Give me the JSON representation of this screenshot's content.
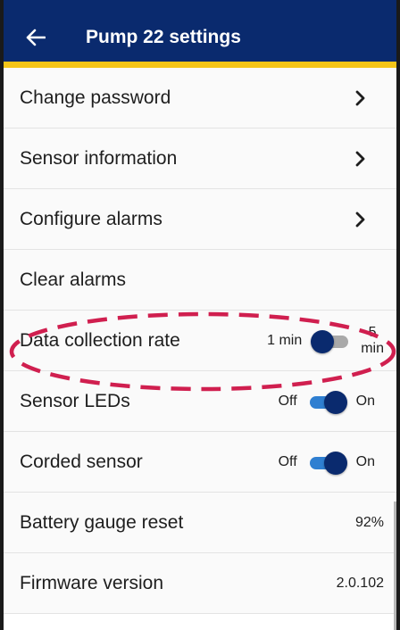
{
  "header": {
    "title": "Pump 22 settings",
    "back_icon": "arrow-left-icon",
    "bar_color": "#0a2a6e",
    "accent_color": "#f5c518"
  },
  "menu": {
    "change_password": "Change password",
    "sensor_information": "Sensor information",
    "configure_alarms": "Configure alarms",
    "clear_alarms": "Clear alarms"
  },
  "settings": {
    "data_collection_rate": {
      "label": "Data collection rate",
      "left_option": "1 min",
      "right_option_line1": "5",
      "right_option_line2": "min",
      "selected": "1 min"
    },
    "sensor_leds": {
      "label": "Sensor LEDs",
      "off_label": "Off",
      "on_label": "On",
      "state": "On"
    },
    "corded_sensor": {
      "label": "Corded sensor",
      "off_label": "Off",
      "on_label": "On",
      "state": "On"
    },
    "battery_gauge_reset": {
      "label": "Battery gauge reset",
      "value": "92%"
    },
    "firmware_version": {
      "label": "Firmware version",
      "value": "2.0.102"
    }
  },
  "highlight_color": "#d01f4f"
}
